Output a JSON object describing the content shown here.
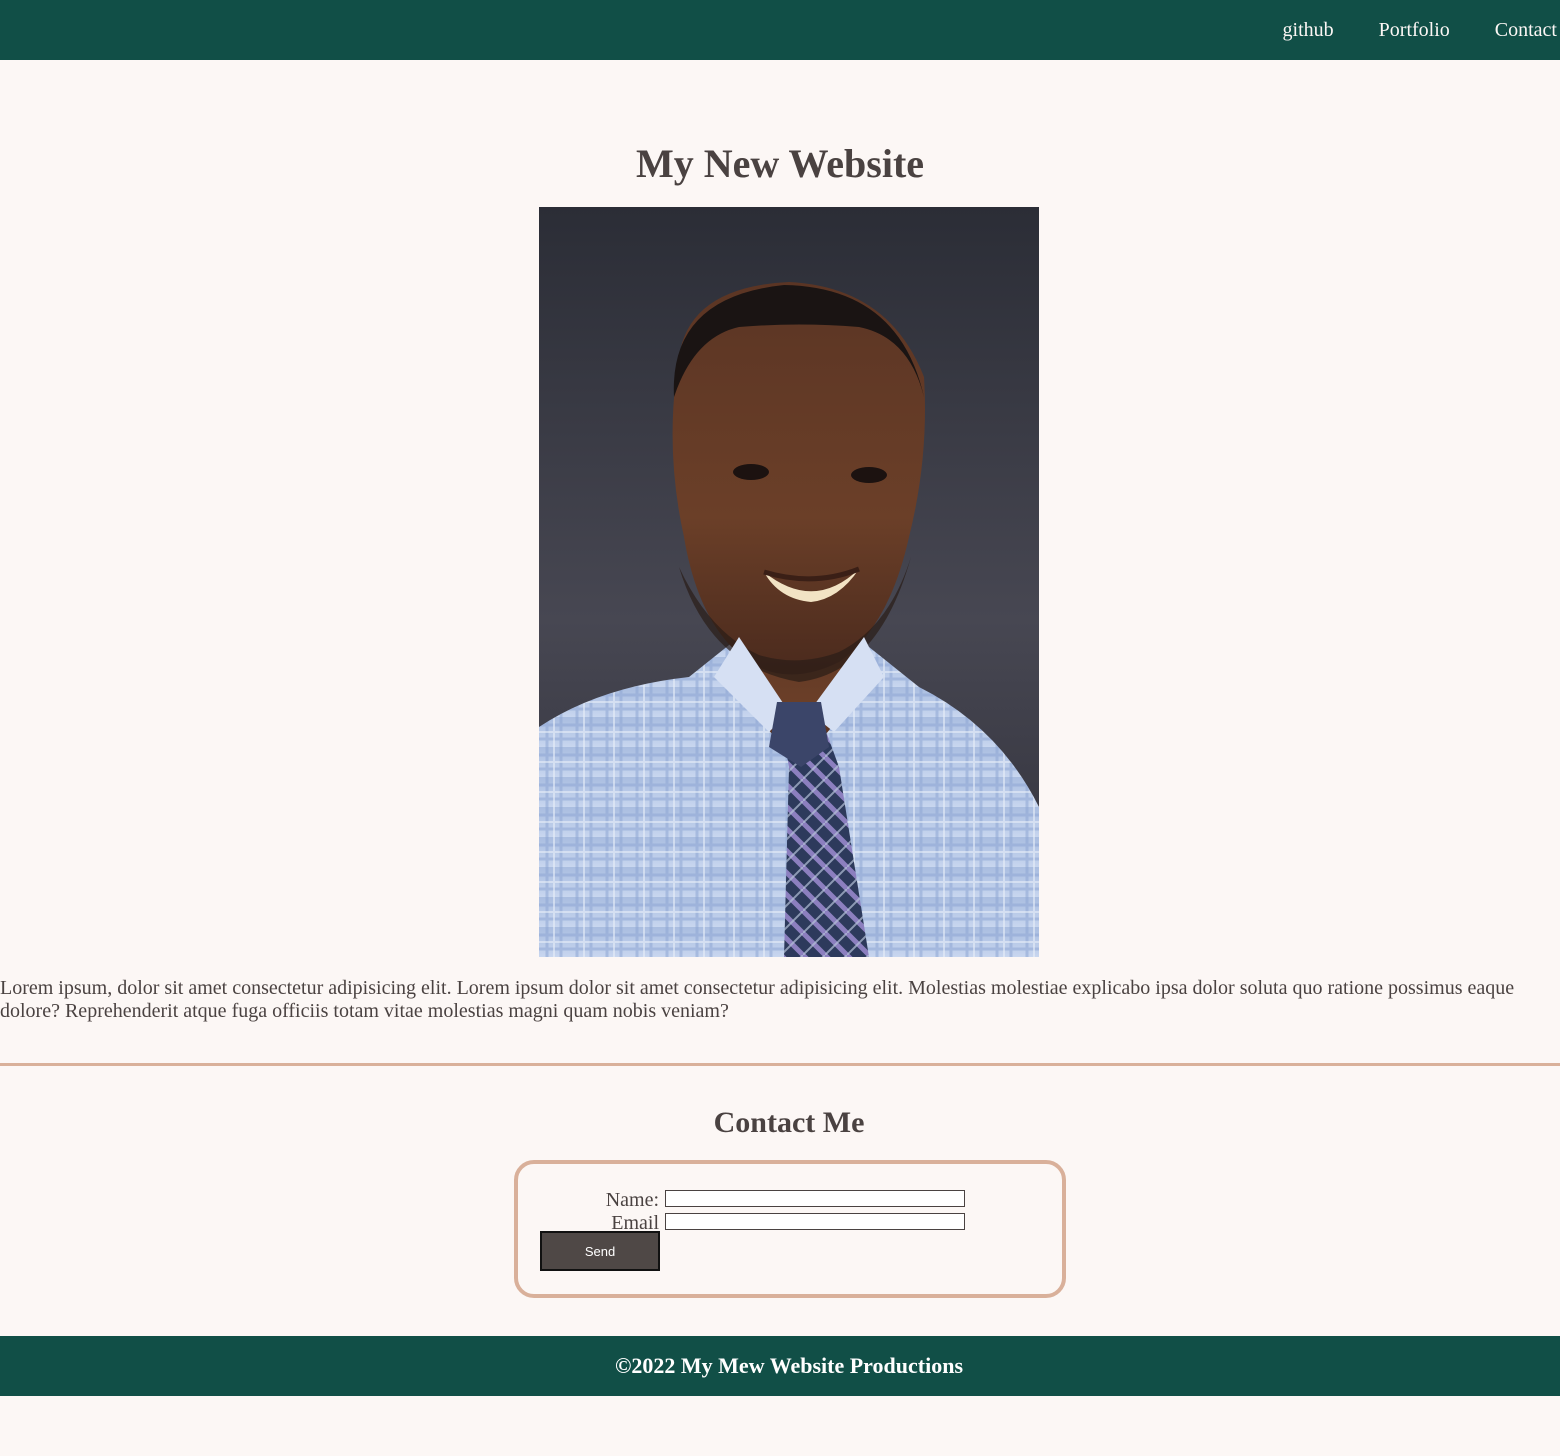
{
  "nav": {
    "links": [
      {
        "label": "github"
      },
      {
        "label": "Portfolio"
      },
      {
        "label": "Contact"
      }
    ]
  },
  "main": {
    "title": "My New Website",
    "intro": "Lorem ipsum, dolor sit amet consectetur adipisicing elit. Lorem ipsum dolor sit amet consectetur adipisicing elit. Molestias molestiae explicabo ipsa dolor soluta quo ratione possimus eaque dolore? Reprehenderit atque fuga officiis totam vitae molestias magni quam nobis veniam?"
  },
  "contact": {
    "title": "Contact Me",
    "name_label": "Name:",
    "email_label": "Email",
    "name_value": "",
    "email_value": "",
    "send_label": "Send"
  },
  "footer": {
    "text": "©2022 My Mew Website Productions"
  },
  "colors": {
    "header_bg": "#114f47",
    "page_bg": "#fcf7f5",
    "accent_border": "#d9b09a",
    "text": "#4a4241",
    "button_bg": "#4f4846"
  },
  "icons": {
    "portrait": "profile-photo"
  }
}
